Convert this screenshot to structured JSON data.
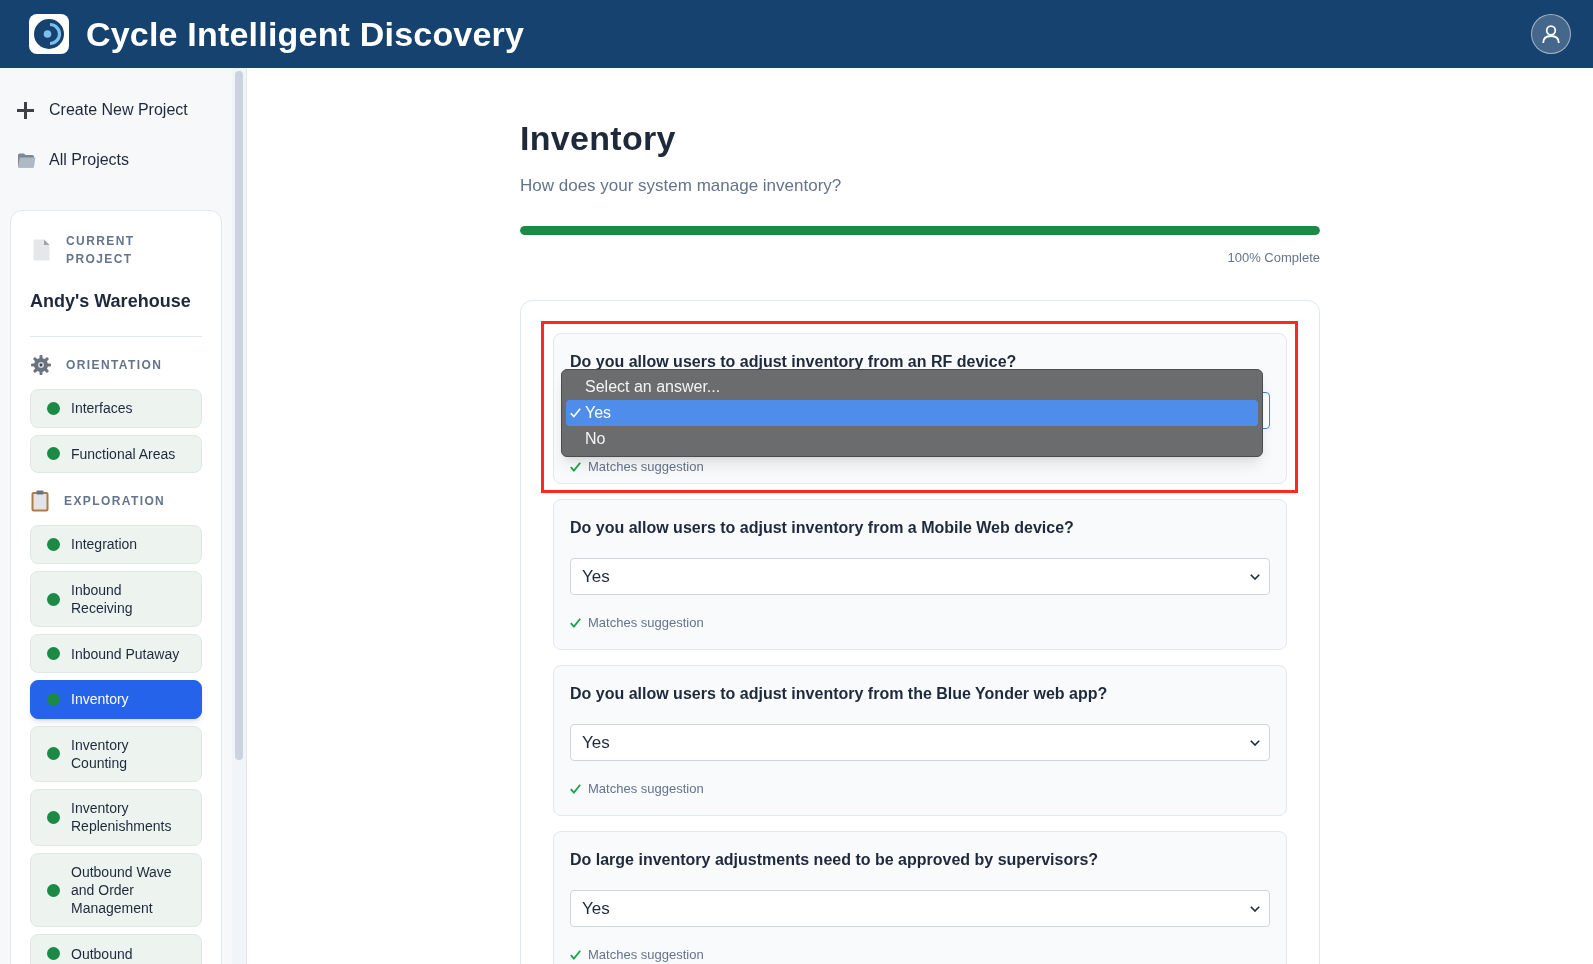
{
  "header": {
    "title": "Cycle Intelligent Discovery"
  },
  "sidebar": {
    "actions": [
      {
        "kind": "create",
        "label": "Create New Project"
      },
      {
        "kind": "folder",
        "label": "All Projects"
      }
    ],
    "current_project": {
      "caption": "CURRENT PROJECT",
      "name": "Andy's Warehouse"
    },
    "sections": [
      {
        "kind": "gear",
        "title": "ORIENTATION",
        "items": [
          {
            "label": "Interfaces",
            "selected": false,
            "color": "#1b8a45"
          },
          {
            "label": "Functional Areas",
            "selected": false,
            "color": "#1b8a45"
          }
        ]
      },
      {
        "kind": "clipboard",
        "title": "EXPLORATION",
        "items": [
          {
            "label": "Integration",
            "selected": false,
            "color": "#1b8a45"
          },
          {
            "label": "Inbound Receiving",
            "selected": false,
            "color": "#1b8a45"
          },
          {
            "label": "Inbound Putaway",
            "selected": false,
            "color": "#1b8a45"
          },
          {
            "label": "Inventory",
            "selected": true,
            "color": "#1b8a45"
          },
          {
            "label": "Inventory Counting",
            "selected": false,
            "color": "#1b8a45"
          },
          {
            "label": "Inventory Replenishments",
            "selected": false,
            "color": "#1b8a45"
          },
          {
            "label": "Outbound Wave and Order Management",
            "selected": false,
            "color": "#1b8a45"
          },
          {
            "label": "Outbound",
            "selected": false,
            "color": "#1b8a45"
          }
        ]
      }
    ]
  },
  "page": {
    "title": "Inventory",
    "subtitle": "How does your system manage inventory?",
    "progress": {
      "level": 1,
      "label": "100% Complete"
    }
  },
  "questions": [
    {
      "question": "Do you allow users to adjust inventory from an RF device?",
      "focused": true,
      "highlighted": true,
      "options": [
        {
          "label": "Select an answer...",
          "selected": false
        },
        {
          "label": "Yes",
          "selected": true
        },
        {
          "label": "No",
          "selected": false
        }
      ],
      "note": "Matches suggestion"
    },
    {
      "question": "Do you allow users to adjust inventory from a Mobile Web device?",
      "focused": false,
      "highlighted": false,
      "value": "Yes",
      "note": "Matches suggestion"
    },
    {
      "question": "Do you allow users to adjust inventory from the Blue Yonder web app?",
      "focused": false,
      "highlighted": false,
      "value": "Yes",
      "note": "Matches suggestion"
    },
    {
      "question": "Do large inventory adjustments need to be approved by supervisors?",
      "focused": false,
      "highlighted": false,
      "value": "Yes",
      "note": "Matches suggestion"
    }
  ]
}
